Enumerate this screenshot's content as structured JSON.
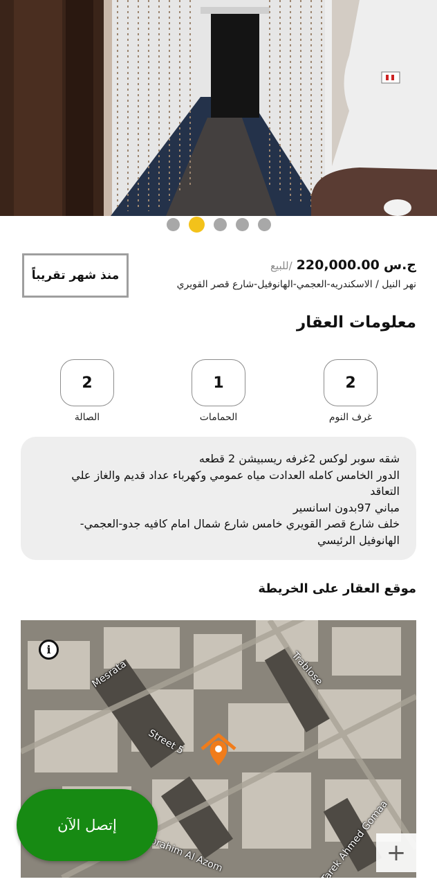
{
  "gallery": {
    "slide_count": 5,
    "active_index": 1
  },
  "listing": {
    "age": "منذ شهر تقريباً",
    "currency": "ج.س",
    "price": "220,000.00",
    "type": "/للبيع",
    "address": "نهر النيل / الاسكندريه-العجمي-الهانوفيل-شارع قصر القويري"
  },
  "info": {
    "title": "معلومات العقار",
    "stats": [
      {
        "value": "2",
        "label": "غرف النوم"
      },
      {
        "value": "1",
        "label": "الحمامات"
      },
      {
        "value": "2",
        "label": "الصالة"
      }
    ],
    "description": "شقه سوبر لوكس 2غرفه ريسبيشن 2 قطعه\nالدور الخامس كامله العدادت مياه عمومي وكهرباء عداد قديم والغاز علي التعاقد\nمباني 97بدون اسانسير\nخلف شارع قصر القويري خامس شارع شمال امام كافيه جدو-العجمي-الهانوفيل الرئيسي"
  },
  "map": {
    "title": "موقع العقار على الخريطة",
    "labels": {
      "mesrata": "Mesrata",
      "trablose": "Trablose",
      "street5": "Street 5",
      "ibrahim": "Ibrahim Al Azom",
      "ahmed": "Tarek Ahmed Gomaa"
    },
    "zoom_label": "+"
  },
  "actions": {
    "call_now": "إتصل الآن"
  },
  "colors": {
    "accent_green": "#178a13",
    "dot_active": "#f3c21a",
    "pin_orange": "#f07c1b"
  }
}
